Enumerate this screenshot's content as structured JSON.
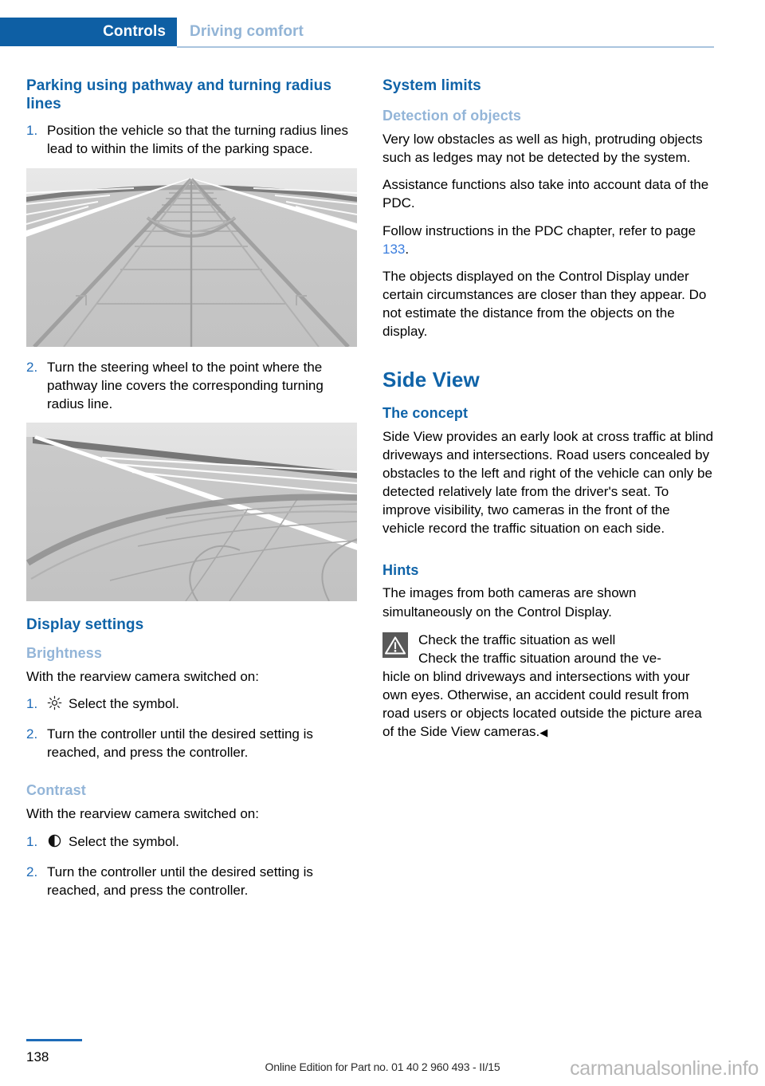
{
  "header": {
    "active_tab": "Controls",
    "inactive_tab": "Driving comfort",
    "active_color": "#0e5fa4",
    "inactive_color": "#92b4d6"
  },
  "left_column": {
    "heading": "Parking using pathway and turning radius lines",
    "steps_parking": [
      {
        "num": "1.",
        "text": "Position the vehicle so that the turning radius lines lead to within the limits of the parking space."
      },
      {
        "num": "2.",
        "text": "Turn the steering wheel to the point where the pathway line covers the corresponding turning radius line."
      }
    ],
    "figure_1_alt": "rearview-camera-pathway-lines-straight",
    "figure_2_alt": "rearview-camera-pathway-lines-turned",
    "display_settings_heading": "Display settings",
    "brightness": {
      "subheading": "Brightness",
      "intro": "With the rearview camera switched on:",
      "icon": "sun-icon",
      "steps": [
        {
          "num": "1.",
          "text": "Select the symbol."
        },
        {
          "num": "2.",
          "text": "Turn the controller until the desired setting is reached, and press the controller."
        }
      ]
    },
    "contrast": {
      "subheading": "Contrast",
      "intro": "With the rearview camera switched on:",
      "icon": "contrast-half-circle-icon",
      "steps": [
        {
          "num": "1.",
          "text": "Select the symbol."
        },
        {
          "num": "2.",
          "text": "Turn the controller until the desired setting is reached, and press the controller."
        }
      ]
    }
  },
  "right_column": {
    "system_limits_heading": "System limits",
    "detection_subheading": "Detection of objects",
    "detection_paragraphs": [
      "Very low obstacles as well as high, protruding objects such as ledges may not be detected by the system.",
      "Assistance functions also take into account data of the PDC."
    ],
    "pdc_refer_prefix": "Follow instructions in the PDC chapter, refer to page ",
    "pdc_refer_page": "133",
    "pdc_refer_suffix": ".",
    "control_display_paragraph": "The objects displayed on the Control Display under certain circumstances are closer than they appear. Do not estimate the distance from the objects on the display.",
    "side_view_title": "Side View",
    "concept_subheading": "The concept",
    "concept_paragraph": "Side View provides an early look at cross traffic at blind driveways and intersections. Road users concealed by obstacles to the left and right of the vehicle can only be detected relatively late from the driver's seat. To improve visibility, two cameras in the front of the vehicle record the traffic situation on each side.",
    "hints_subheading": "Hints",
    "hints_paragraph": "The images from both cameras are shown simultaneously on the Control Display.",
    "warning": {
      "icon": "warning-triangle-icon",
      "title": "Check the traffic situation as well",
      "body_indented": "Check the traffic situation around the ve-",
      "body_rest": "hicle on blind driveways and intersections with your own eyes. Otherwise, an accident could result from road users or objects located outside the picture area of the Side View cameras.",
      "end_mark": "◀"
    }
  },
  "footer": {
    "page_number": "138",
    "edition_line": "Online Edition for Part no. 01 40 2 960 493 - II/15",
    "watermark": "carmanualsonline.info"
  }
}
